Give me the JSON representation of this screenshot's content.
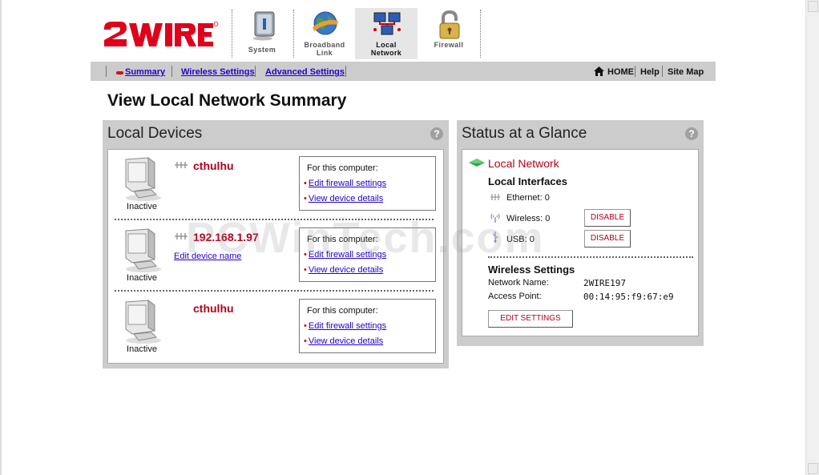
{
  "nav": {
    "tabs": [
      {
        "label": "System",
        "icon": "system-icon"
      },
      {
        "label": "Broadband Link",
        "line1": "Broadband",
        "line2": "Link",
        "icon": "globe-icon"
      },
      {
        "label": "Local Network",
        "line1": "Local",
        "line2": "Network",
        "icon": "local-network-icon",
        "active": true
      },
      {
        "label": "Firewall",
        "icon": "padlock-icon"
      }
    ]
  },
  "subnav": {
    "summary": "Summary",
    "wireless_settings": "Wireless Settings",
    "advanced_settings": "Advanced Settings",
    "home": "HOME",
    "help": "Help",
    "site_map": "Site Map"
  },
  "page_title": "View Local Network Summary",
  "local_devices": {
    "title": "Local Devices",
    "help": "?",
    "devices": [
      {
        "name": "cthulhu",
        "status": "Inactive",
        "box_caption": "For this computer:",
        "link1": "Edit firewall settings",
        "link2": "View device details"
      },
      {
        "name": "192.168.1.97",
        "edit_name": "Edit device name",
        "status": "Inactive",
        "box_caption": "For this computer:",
        "link1": "Edit firewall settings",
        "link2": "View device details"
      },
      {
        "name": "cthulhu",
        "status": "Inactive",
        "box_caption": "For this computer:",
        "link1": "Edit firewall settings",
        "link2": "View device details"
      }
    ]
  },
  "status": {
    "title": "Status at a Glance",
    "help": "?",
    "local_network": "Local Network",
    "local_interfaces": "Local Interfaces",
    "ethernet": "Ethernet: 0",
    "wireless": "Wireless: 0",
    "usb": "USB: 0",
    "disable": "DISABLE",
    "wireless_settings": "Wireless Settings",
    "network_name_label": "Network Name:",
    "network_name": "2WIRE197",
    "access_point_label": "Access Point:",
    "access_point": "00:14:95:f9:67:e9",
    "edit_settings": "EDIT SETTINGS"
  },
  "watermark": "PCWinTech.com",
  "colors": {
    "brand_red": "#e0001a",
    "link_blue": "#2200cc",
    "panel_gray": "#cccccc",
    "accent_green": "#2aa84a"
  }
}
